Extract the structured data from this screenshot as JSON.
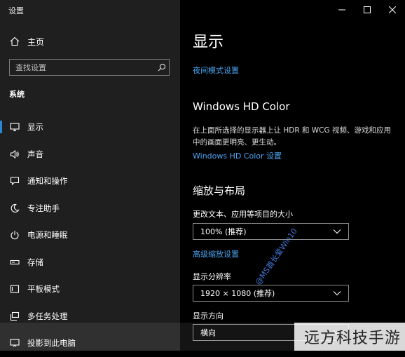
{
  "window": {
    "title": "设置",
    "minimize": "—",
    "maximize": "☐",
    "close": "✕"
  },
  "sidebar": {
    "home_label": "主页",
    "search_placeholder": "查找设置",
    "section": "系统",
    "items": [
      {
        "label": "显示",
        "icon": "monitor-icon",
        "active": true
      },
      {
        "label": "声音",
        "icon": "speaker-icon"
      },
      {
        "label": "通知和操作",
        "icon": "notification-icon"
      },
      {
        "label": "专注助手",
        "icon": "moon-icon"
      },
      {
        "label": "电源和睡眠",
        "icon": "power-icon"
      },
      {
        "label": "存储",
        "icon": "storage-icon"
      },
      {
        "label": "平板模式",
        "icon": "tablet-icon"
      },
      {
        "label": "多任务处理",
        "icon": "multitask-icon"
      },
      {
        "label": "投影到此电脑",
        "icon": "project-icon"
      }
    ]
  },
  "main": {
    "title": "显示",
    "night_light_link": "夜间模式设置",
    "hdr_heading": "Windows HD Color",
    "hdr_desc": "在上面所选择的显示器上让 HDR 和 WCG 视频、游戏和应用中的画面更明亮、更生动。",
    "hdr_link": "Windows HD Color 设置",
    "scale_heading": "缩放与布局",
    "scale_label": "更改文本、应用等项目的大小",
    "scale_value": "100% (推荐)",
    "advanced_scaling_link": "高级缩放设置",
    "resolution_label": "显示分辨率",
    "resolution_value": "1920 × 1080 (推荐)",
    "orientation_label": "显示方向",
    "orientation_value": "横向"
  },
  "overlay": {
    "watermark": "@MS酋长爱Win10",
    "brand": "远方科技手游"
  },
  "colors": {
    "accent": "#2b86d8",
    "link": "#4aa3f0",
    "sidebar_bg": "#1f1f1f",
    "main_bg": "#000000"
  }
}
